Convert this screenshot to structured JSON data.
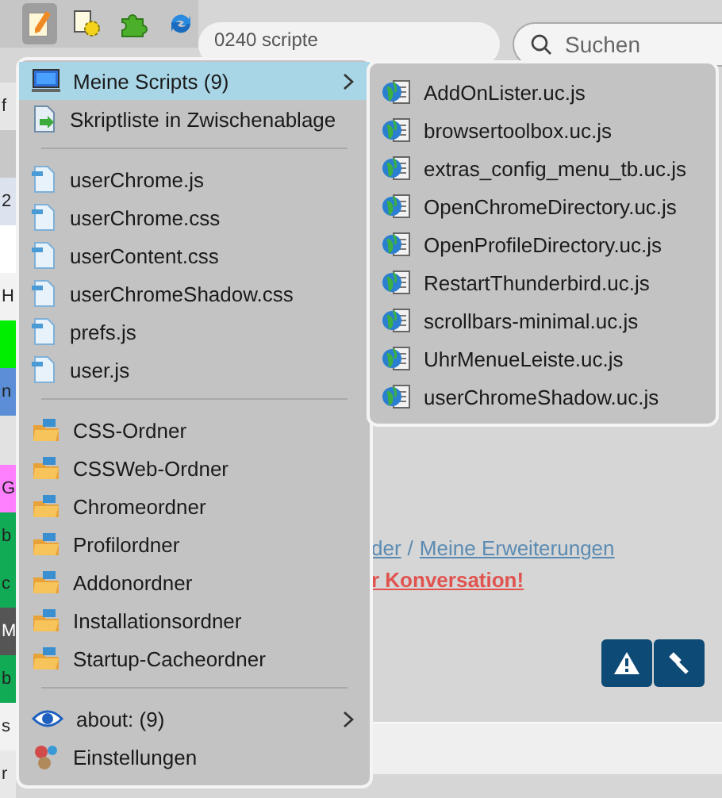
{
  "toolbar": {
    "buttons": [
      {
        "kind": "notepad",
        "selected": true
      },
      {
        "kind": "gear",
        "selected": false
      },
      {
        "kind": "puzzle",
        "selected": false
      },
      {
        "kind": "refresh",
        "selected": false
      }
    ]
  },
  "address_bar": {
    "text": "0240 scripte"
  },
  "search": {
    "placeholder": "Suchen"
  },
  "left_edge": [
    {
      "text": "f",
      "color": "#e6e6e6"
    },
    {
      "color": "#c8c8c8"
    },
    {
      "text": "2",
      "color": "#dde3ee"
    },
    {
      "color": "#ffffff"
    },
    {
      "text": "H",
      "color": "#f2f2f2"
    },
    {
      "color": "#00ee00"
    },
    {
      "text": "n",
      "color": "#5b8ed6"
    },
    {
      "color": "#e2e2e2"
    },
    {
      "text": "G",
      "color": "#ff80ff"
    },
    {
      "text": "b",
      "color": "#11aa55"
    },
    {
      "text": "c",
      "color": "#11aa55"
    },
    {
      "text": "M",
      "color": "#555555"
    },
    {
      "text": "b",
      "color": "#11aa55"
    },
    {
      "text": "s",
      "color": "#f2f2f2"
    },
    {
      "text": "r",
      "color": "#e8e8e8"
    }
  ],
  "page": {
    "breadcrumb": [
      {
        "label": "der"
      },
      {
        "label": "Meine Erweiterungen"
      }
    ],
    "separator": "/",
    "alert": "r Konversation!",
    "actions": [
      {
        "kind": "warning"
      },
      {
        "kind": "gavel"
      }
    ]
  },
  "menu": {
    "items": [
      {
        "kind": "scripts",
        "label": "Meine Scripts (9)",
        "selected": true
      },
      {
        "kind": "copy",
        "label": "Skriptliste in Zwischenablage",
        "selected": false
      },
      {
        "kind": "separator"
      },
      {
        "kind": "file",
        "label": "userChrome.js",
        "selected": false
      },
      {
        "kind": "file",
        "label": "userChrome.css",
        "selected": false
      },
      {
        "kind": "file",
        "label": "userContent.css",
        "selected": false
      },
      {
        "kind": "file",
        "label": "userChromeShadow.css",
        "selected": false
      },
      {
        "kind": "file",
        "label": "prefs.js",
        "selected": false
      },
      {
        "kind": "file",
        "label": "user.js",
        "selected": false
      },
      {
        "kind": "separator"
      },
      {
        "kind": "folder",
        "label": "CSS-Ordner",
        "selected": false
      },
      {
        "kind": "folder",
        "label": "CSSWeb-Ordner",
        "selected": false
      },
      {
        "kind": "folder",
        "label": "Chromeordner",
        "selected": false
      },
      {
        "kind": "folder",
        "label": "Profilordner",
        "selected": false
      },
      {
        "kind": "folder",
        "label": "Addonordner",
        "selected": false
      },
      {
        "kind": "folder",
        "label": "Installationsordner",
        "selected": false
      },
      {
        "kind": "folder",
        "label": "Startup-Cacheordner",
        "selected": false
      },
      {
        "kind": "separator"
      },
      {
        "kind": "about",
        "label": "about: (9)",
        "selected": false
      },
      {
        "kind": "settings",
        "label": "Einstellungen",
        "selected": false
      }
    ]
  },
  "submenu": {
    "items": [
      {
        "label": "AddOnLister.uc.js"
      },
      {
        "label": "browsertoolbox.uc.js"
      },
      {
        "label": "extras_config_menu_tb.uc.js"
      },
      {
        "label": "OpenChromeDirectory.uc.js"
      },
      {
        "label": "OpenProfileDirectory.uc.js"
      },
      {
        "label": "RestartThunderbird.uc.js"
      },
      {
        "label": "scrollbars-minimal.uc.js"
      },
      {
        "label": "UhrMenueLeiste.uc.js"
      },
      {
        "label": "userChromeShadow.uc.js"
      }
    ]
  }
}
